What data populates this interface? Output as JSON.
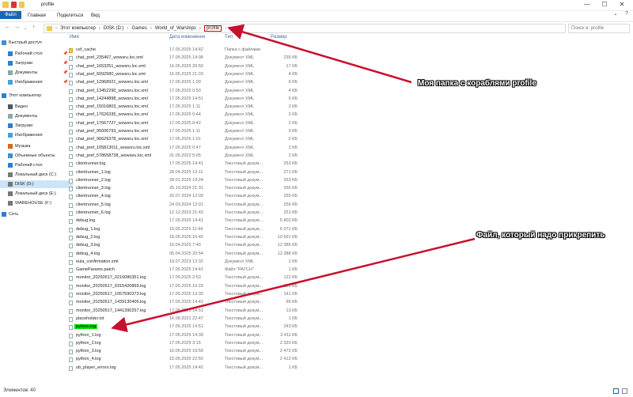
{
  "window": {
    "title": "profile",
    "controls": {
      "minimize": "—",
      "maximize": "☐",
      "close": "✕"
    }
  },
  "ribbon": {
    "tabs": [
      {
        "label": "Файл"
      },
      {
        "label": "Главная"
      },
      {
        "label": "Поделиться"
      },
      {
        "label": "Вид"
      }
    ]
  },
  "address": {
    "segments": [
      "Этот компьютер",
      "DISK (D:)",
      "Games",
      "World_of_Warships",
      "profile"
    ],
    "search_placeholder": "Поиск в: profile"
  },
  "columns": {
    "name": "Имя",
    "date": "Дата изменения",
    "type": "Тип",
    "size": "Размер"
  },
  "sidebar": {
    "items": [
      {
        "label": "Быстрый доступ",
        "icon": "star-icon",
        "color": "#3c8ee0"
      },
      {
        "label": "Рабочий стол",
        "icon": "desktop-icon",
        "color": "#2d7fd3",
        "pin": "📌"
      },
      {
        "label": "Загрузки",
        "icon": "download-icon",
        "color": "#2d7fd3",
        "pin": "📌"
      },
      {
        "label": "Документы",
        "icon": "documents-icon",
        "color": "#8aa",
        "pin": "📌"
      },
      {
        "label": "Изображения",
        "icon": "pictures-icon",
        "color": "#4aa0d8",
        "pin": "📌"
      },
      {
        "label": "Этот компьютер",
        "icon": "computer-icon",
        "color": "#2d7fd3"
      },
      {
        "label": "Видео",
        "icon": "video-icon",
        "color": "#555"
      },
      {
        "label": "Документы",
        "icon": "documents-icon",
        "color": "#8aa"
      },
      {
        "label": "Загрузки",
        "icon": "download-icon",
        "color": "#2d7fd3"
      },
      {
        "label": "Изображения",
        "icon": "pictures-icon",
        "color": "#4aa0d8"
      },
      {
        "label": "Музыка",
        "icon": "music-icon",
        "color": "#d46a1c"
      },
      {
        "label": "Объемные объекты",
        "icon": "3d-objects-icon",
        "color": "#3a8fd0"
      },
      {
        "label": "Рабочий стол",
        "icon": "desktop-icon",
        "color": "#2d7fd3"
      },
      {
        "label": "Локальный диск (C:)",
        "icon": "drive-icon",
        "color": "#777"
      },
      {
        "label": "DISK (D:)",
        "icon": "drive-icon",
        "color": "#777"
      },
      {
        "label": "Локальный диск (E:)",
        "icon": "drive-icon",
        "color": "#777"
      },
      {
        "label": "WAREHOUSE (F:)",
        "icon": "drive-icon",
        "color": "#777"
      },
      {
        "label": "Сеть",
        "icon": "network-icon",
        "color": "#2d7fd3"
      }
    ]
  },
  "files": [
    {
      "name": "cef_cache",
      "date": "17.05.2025 14:42",
      "type": "Папка с файлами",
      "size": "",
      "folder": true
    },
    {
      "name": "chat_pref_235467_wowsru.loc.xml",
      "date": "17.05.2025 14:08",
      "type": "Документ XML",
      "size": "235 КБ"
    },
    {
      "name": "chat_pref_1653251_wowsru.loc.xml",
      "date": "16.05.2025 20:50",
      "type": "Документ XML",
      "size": "17 КБ"
    },
    {
      "name": "chat_pref_6092580_wowsru.loc.xml",
      "date": "16.05.2025 21:03",
      "type": "Документ XML",
      "size": "4 КБ"
    },
    {
      "name": "chat_pref_12968921_wowsru.loc.xml",
      "date": "17.05.2025 1:09",
      "type": "Документ XML",
      "size": "6 КБ"
    },
    {
      "name": "chat_pref_13452290_wowsru.loc.xml",
      "date": "17.05.2025 0:50",
      "type": "Документ XML",
      "size": "4 КБ"
    },
    {
      "name": "chat_pref_14244898_wowsru.loc.xml",
      "date": "17.05.2025 14:51",
      "type": "Документ XML",
      "size": "6 КБ"
    },
    {
      "name": "chat_pref_15016803_wowsru.loc.xml",
      "date": "17.05.2025 1:11",
      "type": "Документ XML",
      "size": "3 КБ"
    },
    {
      "name": "chat_pref_17626335_wowsru.loc.xml",
      "date": "17.05.2025 0:44",
      "type": "Документ XML",
      "size": "2 КБ"
    },
    {
      "name": "chat_pref_17667727_wowsru.loc.xml",
      "date": "17.05.2025 0:42",
      "type": "Документ XML",
      "size": "2 КБ"
    },
    {
      "name": "chat_pref_95606793_wowsru.loc.xml",
      "date": "17.05.2025 1:11",
      "type": "Документ XML",
      "size": "3 КБ"
    },
    {
      "name": "chat_pref_96629378_wowsru.loc.xml",
      "date": "17.05.2025 1:01",
      "type": "Документ XML",
      "size": "2 КБ"
    },
    {
      "name": "chat_pref_105813011_wowsru.loc.xml",
      "date": "17.05.2025 0:47",
      "type": "Документ XML",
      "size": "2 КБ"
    },
    {
      "name": "chat_pref_578658738_wowseu.loc.xml",
      "date": "31.05.2022 5:05",
      "type": "Документ XML",
      "size": "2 КБ"
    },
    {
      "name": "clientrunner.log",
      "date": "17.05.2025 14:41",
      "type": "Текстовый докум...",
      "size": "253 КБ"
    },
    {
      "name": "clientrunner_1.log",
      "date": "28.04.2025 13:11",
      "type": "Текстовый докум...",
      "size": "271 КБ"
    },
    {
      "name": "clientrunner_2.log",
      "date": "28.01.2025 19:24",
      "type": "Текстовый докум...",
      "size": "263 КБ"
    },
    {
      "name": "clientrunner_3.log",
      "date": "25.10.2024 21:31",
      "type": "Текстовый докум...",
      "size": "256 КБ"
    },
    {
      "name": "clientrunner_4.log",
      "date": "20.07.2024 12:09",
      "type": "Текстовый докум...",
      "size": "255 КБ"
    },
    {
      "name": "clientrunner_5.log",
      "date": "24.03.2024 12:01",
      "type": "Текстовый докум...",
      "size": "256 КБ"
    },
    {
      "name": "clientrunner_6.log",
      "date": "12.12.2023 21:43",
      "type": "Текстовый докум...",
      "size": "251 КБ"
    },
    {
      "name": "debug.log",
      "date": "17.05.2025 14:41",
      "type": "Текстовый докум...",
      "size": "5 802 КБ"
    },
    {
      "name": "debug_1.log",
      "date": "10.05.2025 11:44",
      "type": "Текстовый докум...",
      "size": "6 071 КБ"
    },
    {
      "name": "debug_2.log",
      "date": "18.05.2025 10:40",
      "type": "Текстовый докум...",
      "size": "10 691 КБ"
    },
    {
      "name": "debug_3.log",
      "date": "16.04.2025 7:40",
      "type": "Текстовый докум...",
      "size": "12 386 КБ"
    },
    {
      "name": "debug_4.log",
      "date": "05.04.2025 20:54",
      "type": "Текстовый докум...",
      "size": "12 388 КБ"
    },
    {
      "name": "eula_confirmation.xml",
      "date": "19.07.2023 12:32",
      "type": "Документ XML",
      "size": "1 КБ"
    },
    {
      "name": "GameParams.patch",
      "date": "17.05.2025 14:41",
      "type": "Файл \"PATCH\"",
      "size": "1 КБ"
    },
    {
      "name": "monitor_20250517_0216080351.log",
      "date": "17.05.2025 2:53",
      "type": "Текстовый докум...",
      "size": "122 КБ"
    },
    {
      "name": "monitor_20250517_0315420869.log",
      "date": "17.05.2025 10:29",
      "type": "Текстовый докум...",
      "size": "125 КБ"
    },
    {
      "name": "monitor_20250517_1057590373.log",
      "date": "17.05.2025 13:30",
      "type": "Текстовый докум...",
      "size": "141 КБ"
    },
    {
      "name": "monitor_20250517_1439130406.log",
      "date": "17.05.2025 14:41",
      "type": "Текстовый докум...",
      "size": "96 КБ"
    },
    {
      "name": "monitor_20250517_1441390257.log",
      "date": "17.05.2025 14:51",
      "type": "Текстовый докум...",
      "size": "13 КБ"
    },
    {
      "name": "placeholder.txt",
      "date": "16.08.2021 22:47",
      "type": "Текстовый докум...",
      "size": "1 КБ"
    },
    {
      "name": "python.log",
      "date": "17.05.2025 14:51",
      "type": "Текстовый докум...",
      "size": "243 КБ",
      "highlight": true
    },
    {
      "name": "python_1.log",
      "date": "17.05.2025 14:39",
      "type": "Текстовый докум...",
      "size": "2 411 КБ"
    },
    {
      "name": "python_2.log",
      "date": "17.05.2025 3:15",
      "type": "Текстовый докум...",
      "size": "2 320 КБ"
    },
    {
      "name": "python_3.log",
      "date": "16.05.2025 19:59",
      "type": "Текстовый докум...",
      "size": "2 472 КБ"
    },
    {
      "name": "python_4.log",
      "date": "15.05.2025 22:50",
      "type": "Текстовый докум...",
      "size": "2 412 КБ"
    },
    {
      "name": "ub_player_errors.log",
      "date": "17.05.2025 14:42",
      "type": "Текстовый докум...",
      "size": "1 КБ"
    }
  ],
  "status": {
    "count": "Элементов: 40"
  },
  "annotations": {
    "folder_note": "Моя папка с кораблями profile",
    "file_note": "Файл, который надо прикрепить"
  },
  "colors": {
    "accent": "#1b65b4",
    "highlight": "#00e000",
    "arrow": "#c8102e"
  }
}
